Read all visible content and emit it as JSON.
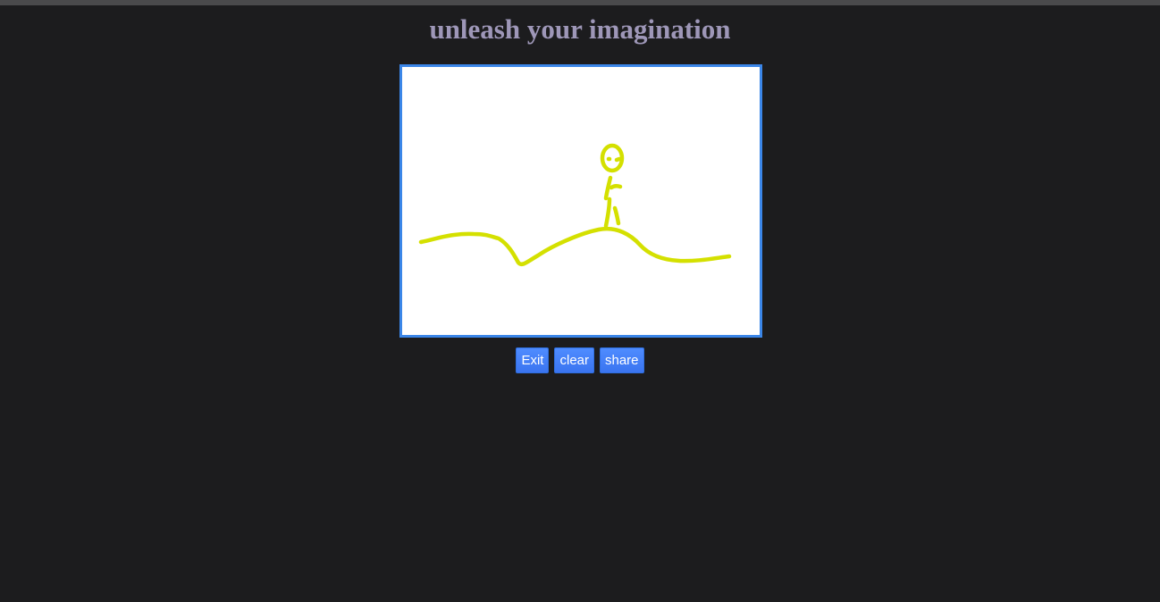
{
  "page": {
    "title": "unleash your imagination"
  },
  "canvas": {
    "stroke_color": "#d4e000",
    "background": "#ffffff",
    "border_color": "#3b86e8"
  },
  "controls": {
    "exit_label": "Exit",
    "clear_label": "clear",
    "share_label": "share"
  },
  "colors": {
    "page_background": "#1c1c1e",
    "title_color": "#9e97b8",
    "button_color": "#3f7df7"
  }
}
